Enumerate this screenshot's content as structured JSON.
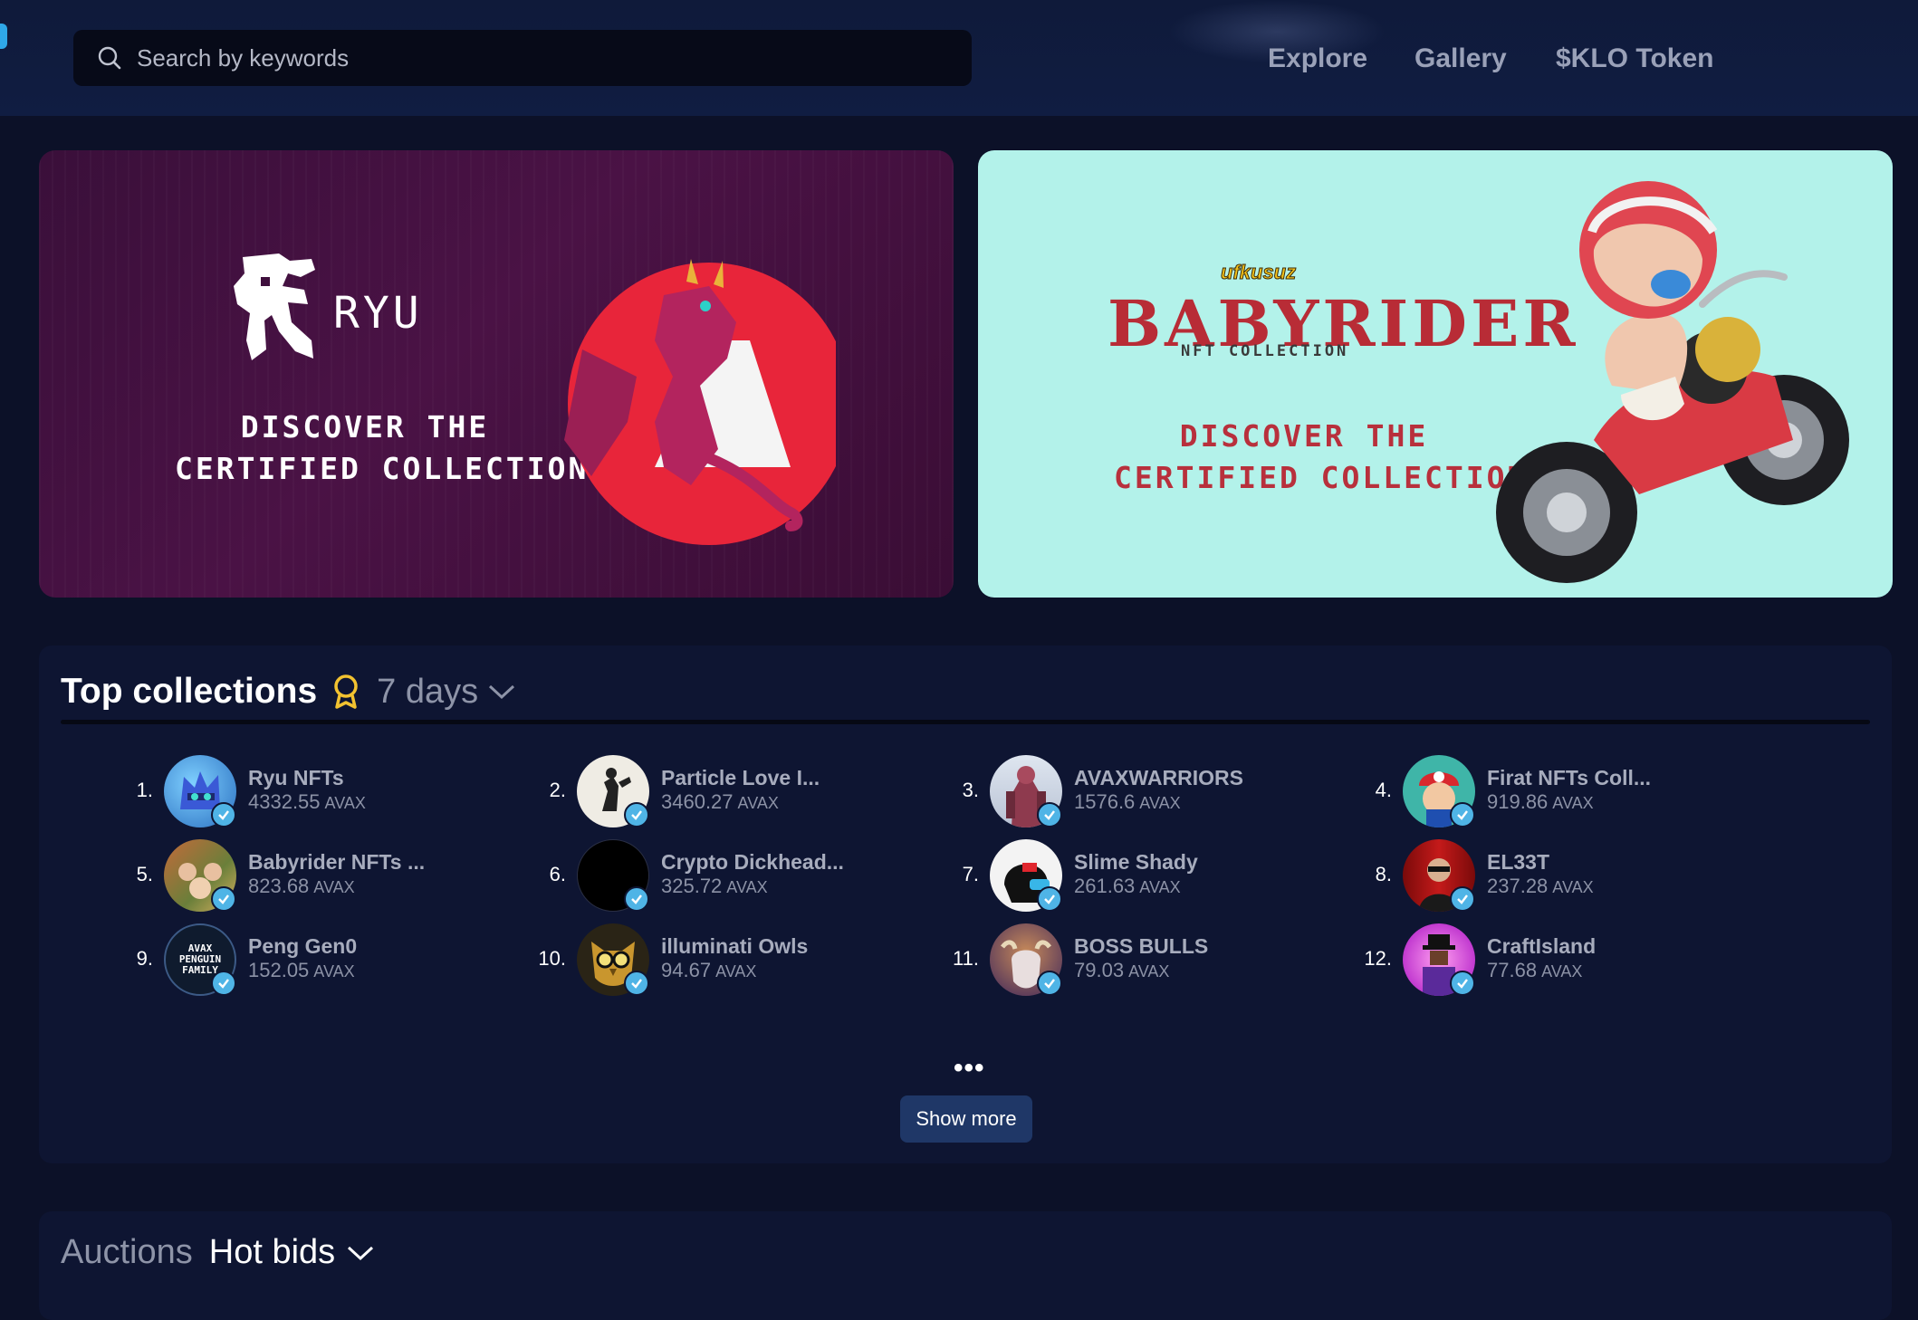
{
  "search": {
    "placeholder": "Search by keywords"
  },
  "nav": {
    "items": [
      "Explore",
      "Gallery",
      "$KLO Token"
    ]
  },
  "banners": [
    {
      "logo_text": "RYU",
      "line1": "DISCOVER THE",
      "line2": "CERTIFIED COLLECTION"
    },
    {
      "brand": "ufkusuz",
      "title": "BABYRIDER",
      "subtitle": "NFT COLLECTION",
      "line1": "DISCOVER THE",
      "line2": "CERTIFIED COLLECTION"
    }
  ],
  "top_collections": {
    "title": "Top collections",
    "period": "7 days",
    "items": [
      {
        "rank": "1.",
        "name": "Ryu NFTs",
        "volume": "4332.55",
        "unit": "AVAX"
      },
      {
        "rank": "2.",
        "name": "Particle Love I...",
        "volume": "3460.27",
        "unit": "AVAX"
      },
      {
        "rank": "3.",
        "name": "AVAXWARRIORS",
        "volume": "1576.6",
        "unit": "AVAX"
      },
      {
        "rank": "4.",
        "name": "Firat NFTs Coll...",
        "volume": "919.86",
        "unit": "AVAX"
      },
      {
        "rank": "5.",
        "name": "Babyrider NFTs ...",
        "volume": "823.68",
        "unit": "AVAX"
      },
      {
        "rank": "6.",
        "name": "Crypto Dickhead...",
        "volume": "325.72",
        "unit": "AVAX"
      },
      {
        "rank": "7.",
        "name": "Slime Shady",
        "volume": "261.63",
        "unit": "AVAX"
      },
      {
        "rank": "8.",
        "name": "EL33T",
        "volume": "237.28",
        "unit": "AVAX"
      },
      {
        "rank": "9.",
        "name": "Peng Gen0",
        "volume": "152.05",
        "unit": "AVAX"
      },
      {
        "rank": "10.",
        "name": "illuminati Owls",
        "volume": "94.67",
        "unit": "AVAX"
      },
      {
        "rank": "11.",
        "name": "BOSS BULLS",
        "volume": "79.03",
        "unit": "AVAX"
      },
      {
        "rank": "12.",
        "name": "CraftIsland",
        "volume": "77.68",
        "unit": "AVAX"
      }
    ],
    "avatar_text_9": "AVAX PENGUIN FAMILY",
    "more_dots": "•••",
    "show_more": "Show more"
  },
  "auctions": {
    "label": "Auctions",
    "selected": "Hot bids"
  },
  "colors": {
    "background": "#0c1128",
    "panel": "#0e1532",
    "verified": "#4fb4e6",
    "button": "#1f3767",
    "babyrider_red": "#b82c36",
    "babyrider_bg": "#b3f2ea"
  }
}
